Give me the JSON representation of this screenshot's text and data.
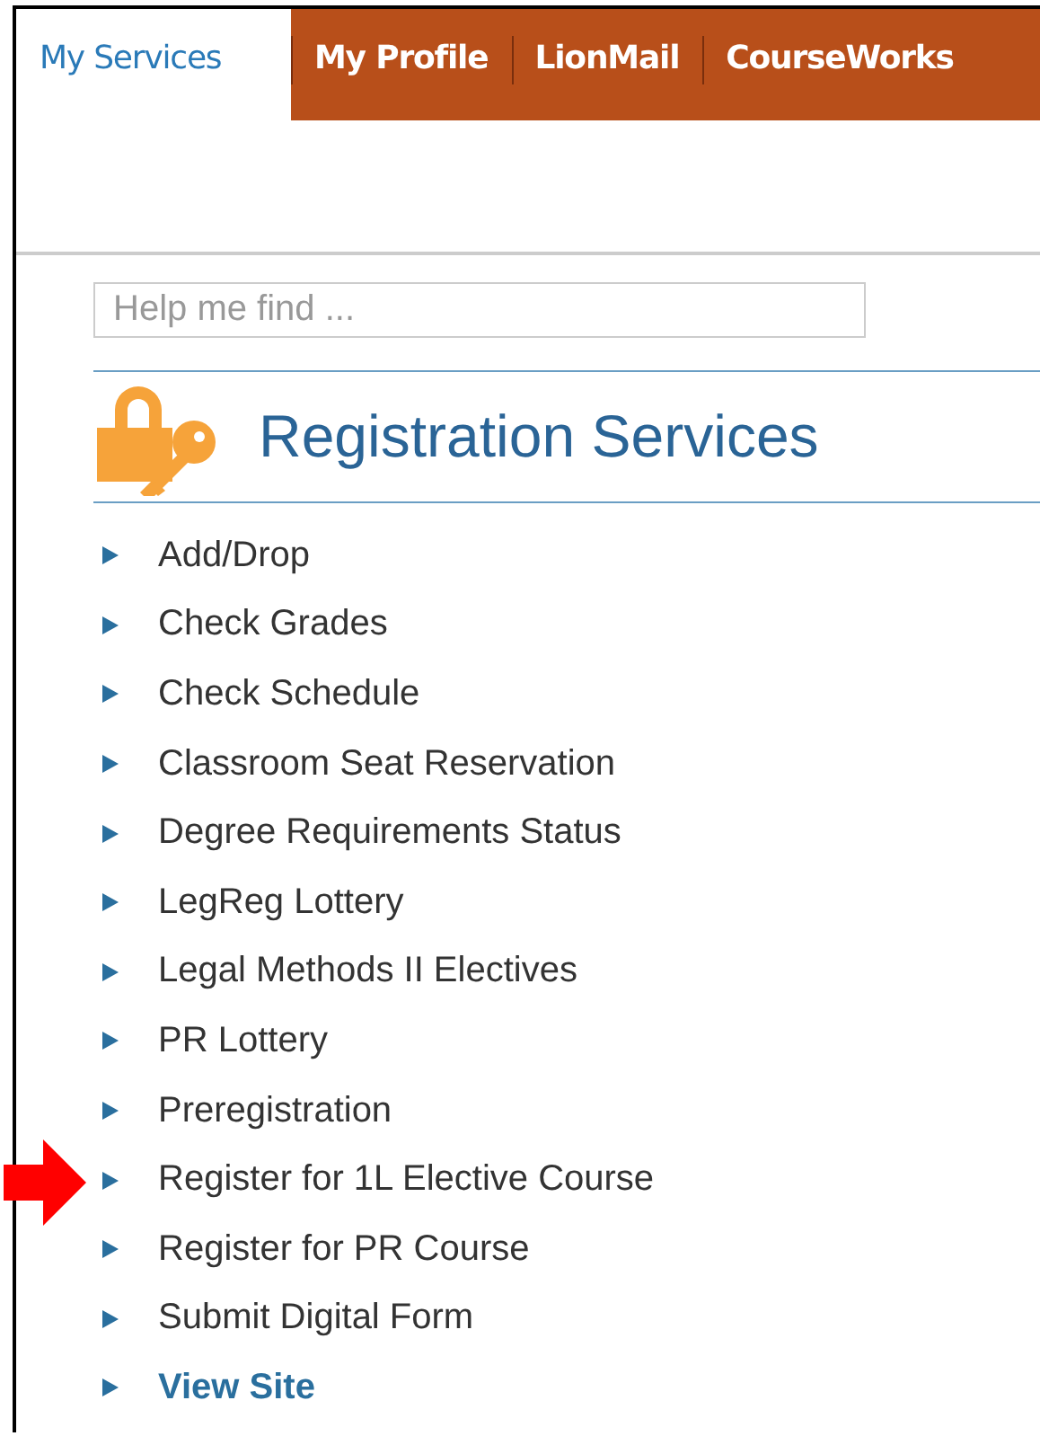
{
  "tabs": [
    {
      "label": "My Services",
      "selected": true
    },
    {
      "label": "My Profile",
      "selected": false
    },
    {
      "label": "LionMail",
      "selected": false
    },
    {
      "label": "CourseWorks",
      "selected": false
    }
  ],
  "search": {
    "placeholder": "Help me find ..."
  },
  "section": {
    "title": "Registration Services"
  },
  "items": [
    {
      "label": "Add/Drop",
      "kind": "service",
      "marked": false
    },
    {
      "label": "Check Grades",
      "kind": "service",
      "marked": false
    },
    {
      "label": "Check Schedule",
      "kind": "service",
      "marked": false
    },
    {
      "label": "Classroom Seat Reservation",
      "kind": "service",
      "marked": false
    },
    {
      "label": "Degree Requirements Status",
      "kind": "service",
      "marked": false
    },
    {
      "label": "LegReg Lottery",
      "kind": "service",
      "marked": false
    },
    {
      "label": "Legal Methods II Electives",
      "kind": "service",
      "marked": false
    },
    {
      "label": "PR Lottery",
      "kind": "service",
      "marked": false
    },
    {
      "label": "Preregistration",
      "kind": "service",
      "marked": false
    },
    {
      "label": "Register for 1L Elective Course",
      "kind": "service",
      "marked": true
    },
    {
      "label": "Register for PR Course",
      "kind": "service",
      "marked": false
    },
    {
      "label": "Submit Digital Form",
      "kind": "service",
      "marked": false
    },
    {
      "label": "View Site",
      "kind": "link",
      "marked": false
    }
  ]
}
